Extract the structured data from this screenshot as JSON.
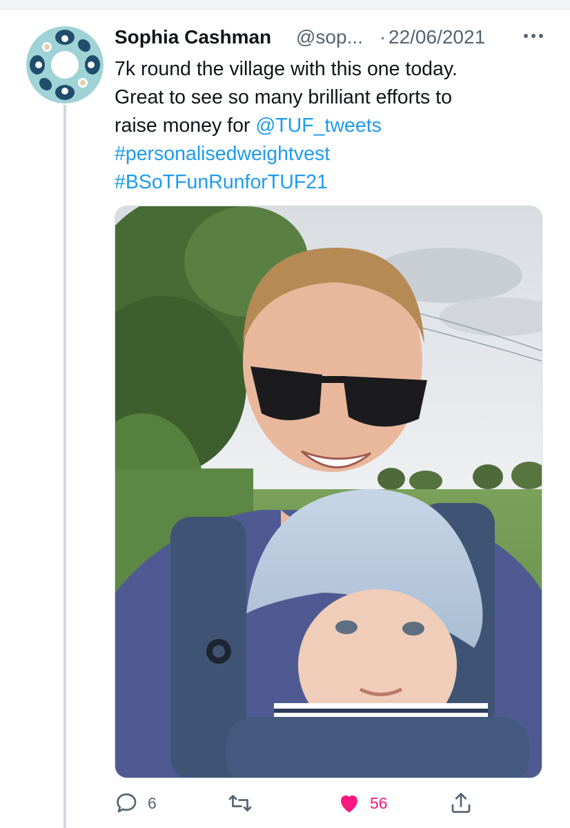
{
  "tweet": {
    "author_name": "Sophia Cashman",
    "author_handle": "@sop...",
    "separator": "·",
    "date": "22/06/2021",
    "text_lines": [
      "7k round the village with this one today.",
      "Great to see so many brilliant efforts to",
      "raise money for "
    ],
    "mention": "@TUF_tweets",
    "hashtags": [
      "#personalisedweightvest",
      "#BSoTFunRunforTUF21"
    ]
  },
  "actions": {
    "reply_count": "6",
    "retweet_count": "",
    "like_count": "56"
  },
  "icons": {
    "more": "more-horizontal-icon",
    "reply": "reply-bubble-icon",
    "retweet": "retweet-arrows-icon",
    "like": "heart-filled-icon",
    "share": "share-upload-icon"
  },
  "colors": {
    "link": "#1d9bf0",
    "like": "#f91880",
    "secondary_text": "#536471",
    "avatar_bg": "#9fd3d6",
    "avatar_figures": "#1f4d6b"
  }
}
